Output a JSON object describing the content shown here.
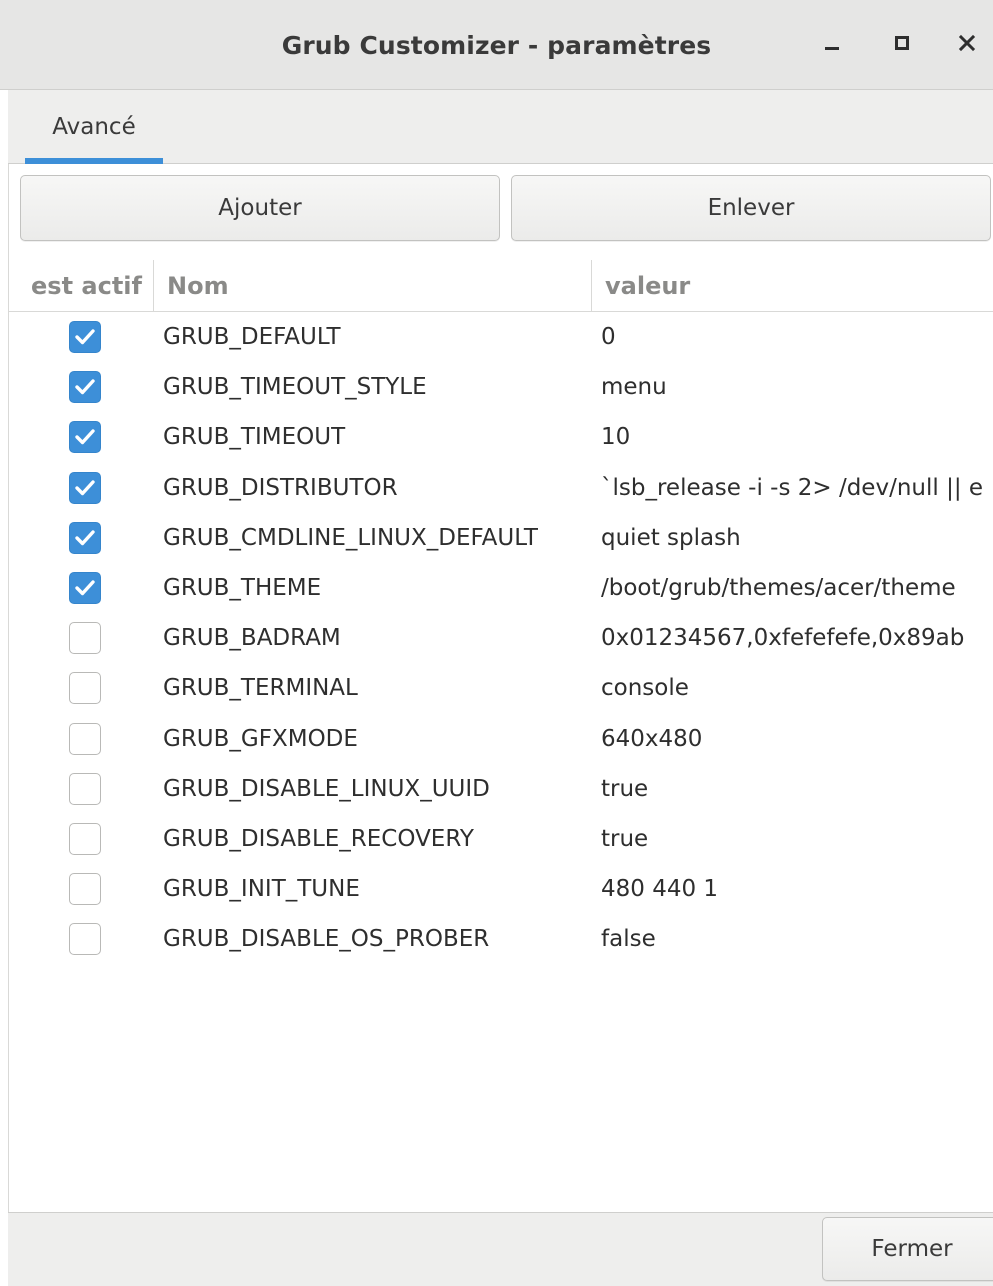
{
  "window": {
    "title": "Grub Customizer - paramètres",
    "controls": {
      "minimize": "minimize-icon",
      "maximize": "maximize-icon",
      "close": "close-icon"
    }
  },
  "tabs": [
    {
      "label": "Avancé",
      "active": true
    }
  ],
  "toolbar": {
    "add_label": "Ajouter",
    "remove_label": "Enlever"
  },
  "table": {
    "columns": {
      "active": "est actif",
      "name": "Nom",
      "value": "valeur"
    },
    "rows": [
      {
        "active": true,
        "name": "GRUB_DEFAULT",
        "value": "0"
      },
      {
        "active": true,
        "name": "GRUB_TIMEOUT_STYLE",
        "value": "menu"
      },
      {
        "active": true,
        "name": "GRUB_TIMEOUT",
        "value": "10"
      },
      {
        "active": true,
        "name": "GRUB_DISTRIBUTOR",
        "value": "`lsb_release -i -s 2> /dev/null || e"
      },
      {
        "active": true,
        "name": "GRUB_CMDLINE_LINUX_DEFAULT",
        "value": "quiet splash"
      },
      {
        "active": true,
        "name": "GRUB_THEME",
        "value": "/boot/grub/themes/acer/theme"
      },
      {
        "active": false,
        "name": "GRUB_BADRAM",
        "value": "0x01234567,0xfefefefe,0x89ab"
      },
      {
        "active": false,
        "name": "GRUB_TERMINAL",
        "value": "console"
      },
      {
        "active": false,
        "name": "GRUB_GFXMODE",
        "value": "640x480"
      },
      {
        "active": false,
        "name": "GRUB_DISABLE_LINUX_UUID",
        "value": "true"
      },
      {
        "active": false,
        "name": "GRUB_DISABLE_RECOVERY",
        "value": "true"
      },
      {
        "active": false,
        "name": "GRUB_INIT_TUNE",
        "value": "480 440 1"
      },
      {
        "active": false,
        "name": "GRUB_DISABLE_OS_PROBER",
        "value": "false"
      }
    ]
  },
  "footer": {
    "close_label": "Fermer"
  },
  "colors": {
    "accent": "#3d8fd8",
    "titlebar": "#e6e6e5",
    "header_text": "#8a8a88"
  }
}
